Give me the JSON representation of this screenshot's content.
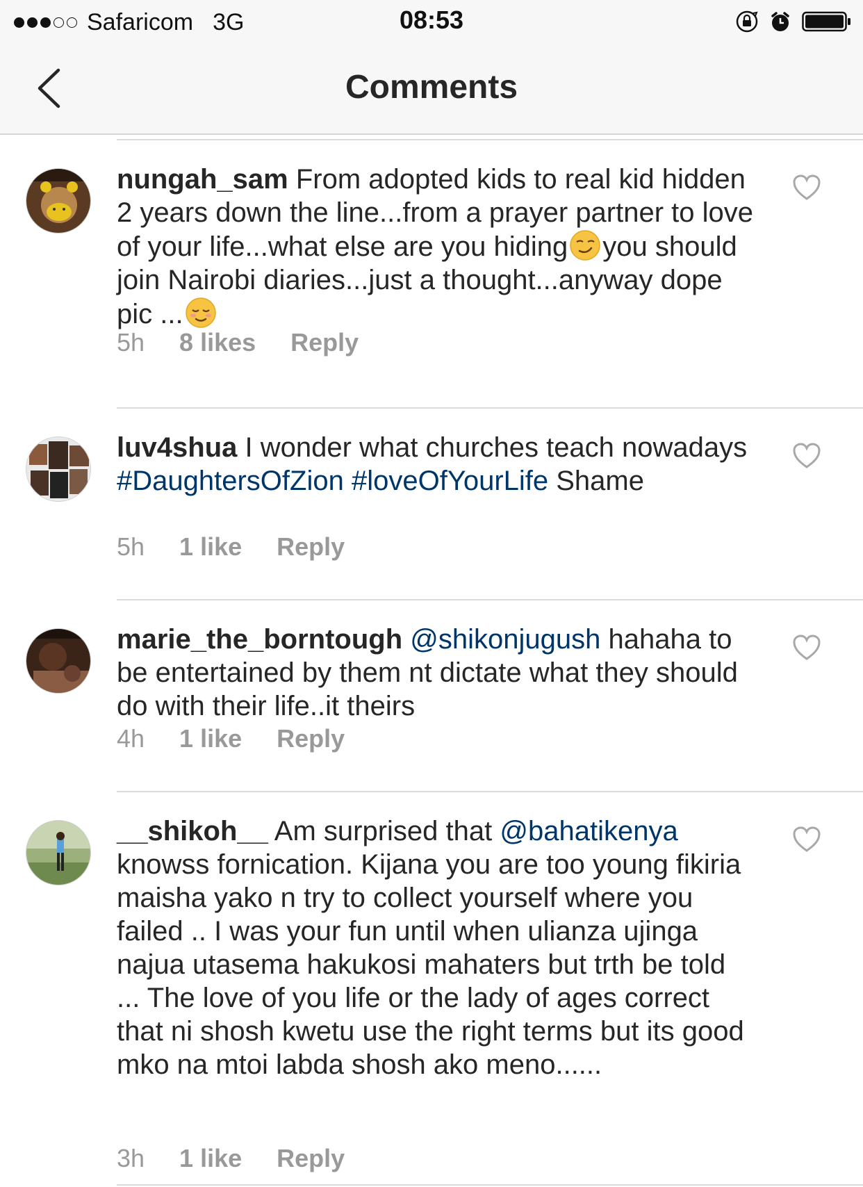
{
  "status_bar": {
    "signal_bars_filled": 3,
    "signal_bars_total": 5,
    "carrier": "Safaricom",
    "network": "3G",
    "time": "08:53",
    "icons": [
      "orientation-lock-icon",
      "alarm-icon",
      "battery-icon"
    ]
  },
  "nav": {
    "title": "Comments",
    "back_icon": "chevron-left-icon"
  },
  "colors": {
    "link": "#003569",
    "meta": "#999999",
    "text": "#262626",
    "bar_bg": "#f7f7f7"
  },
  "comments": [
    {
      "username": "nungah_sam",
      "segments": [
        {
          "type": "text",
          "text": " From adopted kids to real kid hidden 2 years down the line...from a prayer partner to love of your life...what else are you hiding"
        },
        {
          "type": "emoji",
          "name": "smirk-emoji"
        },
        {
          "type": "text",
          "text": "you should join Nairobi diaries...just a thought...anyway dope pic ..."
        },
        {
          "type": "emoji",
          "name": "relieved-emoji"
        }
      ],
      "time": "5h",
      "likes": "8 likes",
      "reply": "Reply"
    },
    {
      "username": "luv4shua",
      "segments": [
        {
          "type": "text",
          "text": " I wonder what churches teach nowadays "
        },
        {
          "type": "hashtag",
          "text": "#DaughtersOfZion"
        },
        {
          "type": "text",
          "text": " "
        },
        {
          "type": "hashtag",
          "text": "#loveOfYourLife"
        },
        {
          "type": "text",
          "text": " Shame"
        }
      ],
      "time": "5h",
      "likes": "1 like",
      "reply": "Reply"
    },
    {
      "username": "marie_the_borntough",
      "segments": [
        {
          "type": "text",
          "text": " "
        },
        {
          "type": "mention",
          "text": "@shikonjugush"
        },
        {
          "type": "text",
          "text": " hahaha to be entertained by them  nt dictate what they should do with their life..it theirs"
        }
      ],
      "time": "4h",
      "likes": "1 like",
      "reply": "Reply"
    },
    {
      "username": "__shikoh__",
      "segments": [
        {
          "type": "text",
          "text": " Am surprised that "
        },
        {
          "type": "mention",
          "text": "@bahatikenya"
        },
        {
          "type": "text",
          "text": " knowss fornication. Kijana you are too young fikiria maisha yako n try to collect yourself where you failed .. I was your fun until when ulianza ujinga najua utasema hakukosi mahaters but trth be told ... The love of you life or the lady of ages correct that ni shosh kwetu use the right terms but its good mko na mtoi labda shosh ako meno......"
        }
      ],
      "time": "3h",
      "likes": "1 like",
      "reply": "Reply"
    }
  ]
}
